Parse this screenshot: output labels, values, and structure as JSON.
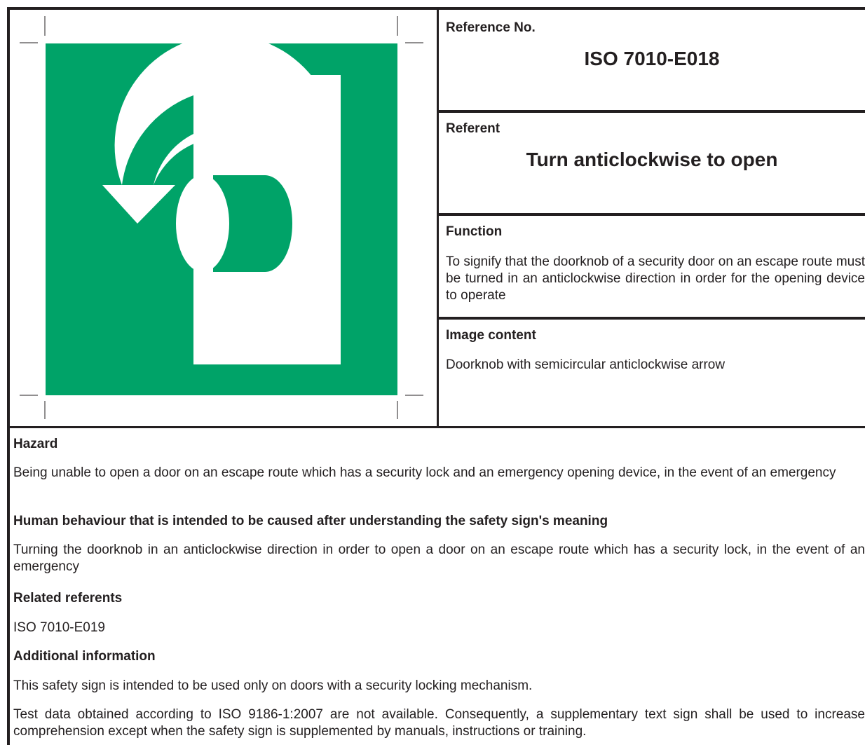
{
  "reference": {
    "label": "Reference No.",
    "value": "ISO 7010-E018"
  },
  "referent": {
    "label": "Referent",
    "value": "Turn anticlockwise to open"
  },
  "function": {
    "label": "Function",
    "text": "To signify that the doorknob of a security door on an escape route must be turned in an anticlockwise direction in order for the opening device to operate"
  },
  "image_content": {
    "label": "Image content",
    "text": "Doorknob with semicircular anticlockwise arrow"
  },
  "hazard": {
    "label": "Hazard",
    "text": "Being unable to open a door on an escape route which has a security lock and an emergency opening device, in the event of an emergency"
  },
  "human_behaviour": {
    "label": "Human behaviour that is intended to be caused after understanding the safety sign's meaning",
    "text": "Turning the doorknob in an anticlockwise direction in order to open a door on an escape route which has a security lock, in the event of an emergency"
  },
  "related_referents": {
    "label": "Related referents",
    "text": "ISO 7010-E019"
  },
  "additional_information": {
    "label": "Additional information",
    "paragraphs": [
      "This safety sign is intended to be used only on doors with a security locking mechanism.",
      "Test data obtained according to ISO 9186-1:2007 are not available. Consequently, a supplementary text sign shall be used to increase comprehension except when the safety sign is supplemented by manuals, instructions or training."
    ]
  },
  "colors": {
    "safe_condition_green": "#00a368",
    "symbol_white": "#ffffff",
    "rule_black": "#231f20"
  },
  "sign": {
    "icon": "doorknob-anticlockwise-arrow-icon"
  }
}
